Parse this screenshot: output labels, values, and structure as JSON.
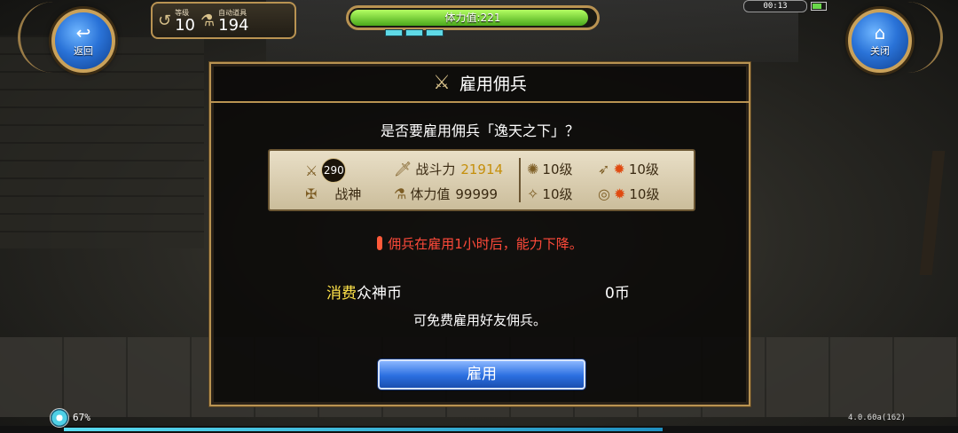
{
  "nav": {
    "back_label": "返回",
    "close_label": "关闭",
    "back_icon": "back-arrow-icon",
    "close_icon": "home-icon"
  },
  "stats": {
    "level_label": "等级",
    "level_value": "10",
    "items_label": "自动道具",
    "items_value": "194"
  },
  "stamina": {
    "text": "体力值:221",
    "fraction": 0.97
  },
  "status": {
    "time": "00:13"
  },
  "dialog": {
    "title": "雇用佣兵",
    "question": "是否要雇用佣兵「逸天之下」？",
    "info": {
      "level": "290",
      "class_name": "战神",
      "power_label": "战斗力",
      "power_value": "21914",
      "hp_label": "体力值",
      "hp_value": "99999",
      "skills": [
        {
          "level": "10级"
        },
        {
          "level": "10级"
        },
        {
          "level": "10级"
        },
        {
          "level": "10级"
        }
      ]
    },
    "warning": "佣兵在雇用1小时后，能力下降。",
    "cost_highlight": "消费",
    "cost_rest": "众神币",
    "cost_value": "0币",
    "friend_note": "可免费雇用好友佣兵。",
    "hire_button": "雇用"
  },
  "footer": {
    "progress_text": "67%",
    "progress_fraction": 0.67,
    "version": "4.0.60a(162)"
  },
  "colors": {
    "accent_gold": "#b99352",
    "button_blue": "#2b6fe0",
    "warning_red": "#ff4a3a",
    "highlight_yellow": "#ffe34a"
  }
}
